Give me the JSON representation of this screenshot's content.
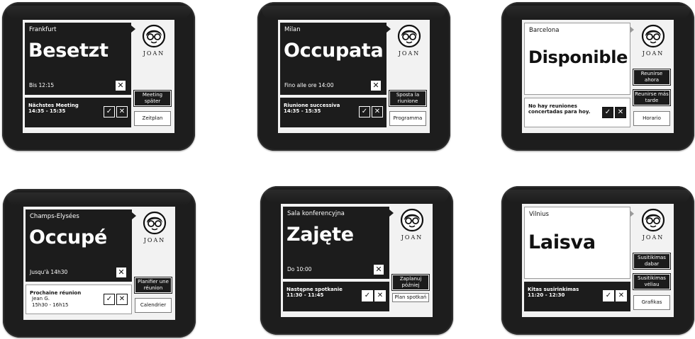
{
  "brand": "JOAN",
  "devices": [
    {
      "location": "Frankfurt",
      "status": "Besetzt",
      "until": "Bis 12:15",
      "next_title": "Nächstes Meeting",
      "next_time": "14:35 - 15:35",
      "btn1": "Meeting später",
      "btn2": "Zeitplan"
    },
    {
      "location": "Milan",
      "status": "Occupata",
      "until": "Fino alle ore 14:00",
      "next_title": "Riunione successiva",
      "next_time": "14:35 - 15:35",
      "btn1": "Sposta la riunione",
      "btn2": "Programma"
    },
    {
      "location": "Barcelona",
      "status": "Disponible",
      "next_title": "No hay reuniones concertadas para hoy.",
      "btn_a": "Reunirse ahora",
      "btn_b": "Reunirse más tarde",
      "btn2": "Horario"
    },
    {
      "location": "Champs-Elysées",
      "status": "Occupé",
      "until": "Jusqu'à 14h30",
      "next_title": "Prochaine réunion",
      "next_sub1": "Jean G.",
      "next_sub2": "15h30 - 16h15",
      "btn1": "Planifier une réunion",
      "btn2": "Calendrier"
    },
    {
      "location": "Sala konferencyjna",
      "status": "Zajęte",
      "until": "Do 10:00",
      "next_title": "Następne spotkanie",
      "next_time": "11:30 - 11:45",
      "btn1": "Zaplanuj później",
      "btn2": "Plan spotkań"
    },
    {
      "location": "Vilnius",
      "status": "Laisva",
      "next_title": "Kitas susirinkimas",
      "next_time": "11:20 - 12:30",
      "btn_a": "Susitikimas dabar",
      "btn_b": "Susitikimas vėliau",
      "btn2": "Grafikas"
    }
  ],
  "icons": {
    "check": "check-icon",
    "close": "close-icon",
    "logo": "joan-face-logo"
  }
}
